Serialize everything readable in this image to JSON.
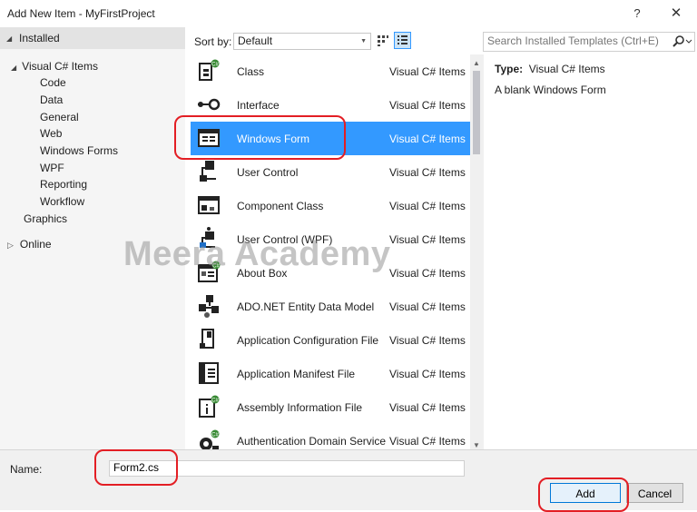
{
  "window": {
    "title": "Add New Item - MyFirstProject",
    "help": "?",
    "close": "✕"
  },
  "sidebar": {
    "header": "Installed",
    "root": "Visual C# Items",
    "children": [
      "Code",
      "Data",
      "General",
      "Web",
      "Windows Forms",
      "WPF",
      "Reporting",
      "Workflow"
    ],
    "graphics": "Graphics",
    "online": "Online"
  },
  "toolbar": {
    "sort_label": "Sort by:",
    "sort_value": "Default"
  },
  "search": {
    "placeholder": "Search Installed Templates (Ctrl+E)"
  },
  "templates": [
    {
      "name": "Class",
      "category": "Visual C# Items",
      "icon": "class-icon"
    },
    {
      "name": "Interface",
      "category": "Visual C# Items",
      "icon": "interface-icon"
    },
    {
      "name": "Windows Form",
      "category": "Visual C# Items",
      "icon": "windows-form-icon",
      "selected": true
    },
    {
      "name": "User Control",
      "category": "Visual C# Items",
      "icon": "user-control-icon"
    },
    {
      "name": "Component Class",
      "category": "Visual C# Items",
      "icon": "component-class-icon"
    },
    {
      "name": "User Control (WPF)",
      "category": "Visual C# Items",
      "icon": "user-control-wpf-icon"
    },
    {
      "name": "About Box",
      "category": "Visual C# Items",
      "icon": "about-box-icon"
    },
    {
      "name": "ADO.NET Entity Data Model",
      "category": "Visual C# Items",
      "icon": "entity-data-model-icon"
    },
    {
      "name": "Application Configuration File",
      "category": "Visual C# Items",
      "icon": "config-file-icon"
    },
    {
      "name": "Application Manifest File",
      "category": "Visual C# Items",
      "icon": "manifest-file-icon"
    },
    {
      "name": "Assembly Information File",
      "category": "Visual C# Items",
      "icon": "assembly-info-icon"
    },
    {
      "name": "Authentication Domain Service",
      "category": "Visual C# Items",
      "icon": "auth-domain-service-icon"
    }
  ],
  "details": {
    "type_label": "Type:",
    "type_value": "Visual C# Items",
    "description": "A blank Windows Form"
  },
  "form": {
    "name_label": "Name:",
    "name_value": "Form2.cs",
    "add_label": "Add",
    "cancel_label": "Cancel"
  },
  "watermark": "Meera Academy",
  "colors": {
    "selection": "#3399ff",
    "highlight_ring": "#e31e24"
  }
}
